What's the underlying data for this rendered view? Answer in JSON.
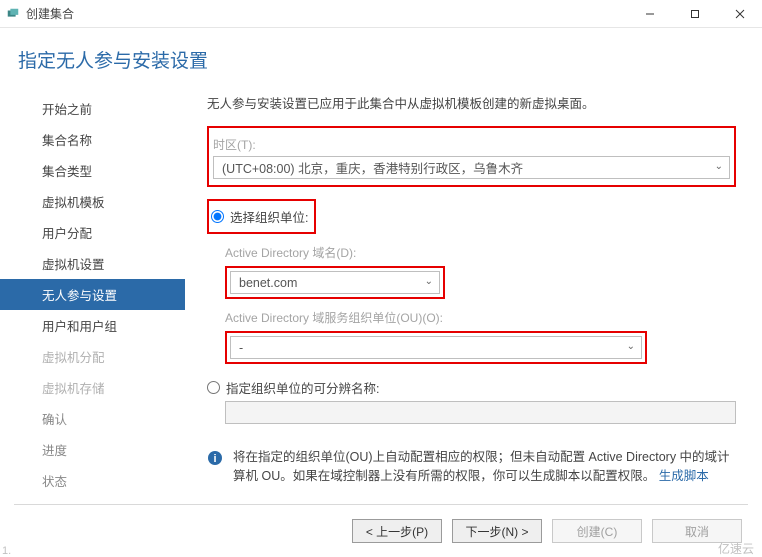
{
  "window": {
    "title": "创建集合"
  },
  "header": {
    "title": "指定无人参与安装设置"
  },
  "sidebar": {
    "items": [
      {
        "label": "开始之前"
      },
      {
        "label": "集合名称"
      },
      {
        "label": "集合类型"
      },
      {
        "label": "虚拟机模板"
      },
      {
        "label": "用户分配"
      },
      {
        "label": "虚拟机设置"
      },
      {
        "label": "无人参与设置",
        "active": true
      },
      {
        "label": "用户和用户组"
      },
      {
        "label": "虚拟机分配",
        "disabled": true
      },
      {
        "label": "虚拟机存储",
        "disabled": true
      },
      {
        "label": "确认",
        "muted": true
      },
      {
        "label": "进度",
        "muted": true
      },
      {
        "label": "状态",
        "muted": true
      }
    ]
  },
  "content": {
    "intro": "无人参与安装设置已应用于此集合中从虚拟机模板创建的新虚拟桌面。",
    "tz_label": "时区(T):",
    "tz_value": "(UTC+08:00) 北京，重庆，香港特别行政区，乌鲁木齐",
    "radio1": "选择组织单位:",
    "ad_domain_label": "Active Directory 域名(D):",
    "ad_domain_value": "benet.com",
    "ad_ou_label": "Active Directory 域服务组织单位(OU)(O):",
    "ad_ou_value": "-",
    "radio2": "指定组织单位的可分辨名称:",
    "info_text1": "将在指定的组织单位(OU)上自动配置相应的权限；但未自动配置 Active Directory 中的域计算机 OU。如果在域控制器上没有所需的权限，你可以生成脚本以配置权限。",
    "info_link": "生成脚本"
  },
  "footer": {
    "prev": "< 上一步(P)",
    "next": "下一步(N) >",
    "create": "创建(C)",
    "cancel": "取消"
  },
  "watermark": "亿速云",
  "page": "1."
}
